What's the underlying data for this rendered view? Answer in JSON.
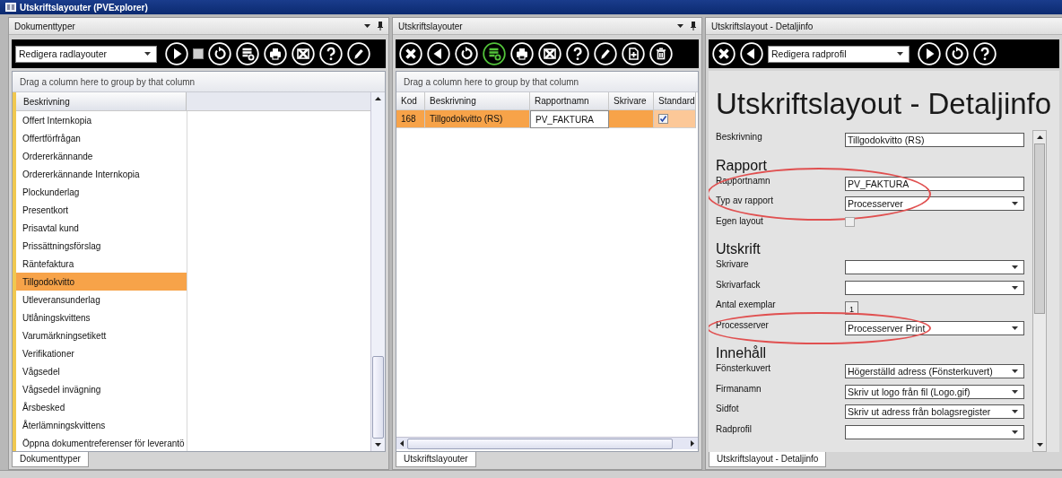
{
  "window": {
    "title": "Utskriftslayouter (PVExplorer)"
  },
  "panes": [
    {
      "kind": "list",
      "title": "Dokumenttyper",
      "pinnable": true,
      "toolbar": [
        {
          "kind": "dropdown",
          "value": "Redigera radlayouter"
        },
        {
          "kind": "play",
          "active": false
        },
        {
          "kind": "stop",
          "active": false
        },
        {
          "kind": "refresh",
          "active": false
        },
        {
          "kind": "columns",
          "active": false
        },
        {
          "kind": "print",
          "active": false
        },
        {
          "kind": "excel",
          "active": false
        },
        {
          "kind": "help",
          "active": false
        },
        {
          "kind": "pencil",
          "active": false
        }
      ],
      "group_hint": "Drag a column here to group by that column",
      "columns": [
        "Beskrivning"
      ],
      "rows": [
        {
          "text": "Offert Internkopia",
          "selected": false
        },
        {
          "text": "Offertförfrågan",
          "selected": false
        },
        {
          "text": "Ordererkännande",
          "selected": false
        },
        {
          "text": "Ordererkännande Internkopia",
          "selected": false
        },
        {
          "text": "Plockunderlag",
          "selected": false
        },
        {
          "text": "Presentkort",
          "selected": false
        },
        {
          "text": "Prisavtal kund",
          "selected": false
        },
        {
          "text": "Prissättningsförslag",
          "selected": false
        },
        {
          "text": "Räntefaktura",
          "selected": false
        },
        {
          "text": "Tillgodokvitto",
          "selected": true
        },
        {
          "text": "Utleveransunderlag",
          "selected": false
        },
        {
          "text": "Utlåningskvittens",
          "selected": false
        },
        {
          "text": "Varumärkningsetikett",
          "selected": false
        },
        {
          "text": "Verifikationer",
          "selected": false
        },
        {
          "text": "Vågsedel",
          "selected": false
        },
        {
          "text": "Vågsedel invägning",
          "selected": false
        },
        {
          "text": "Årsbesked",
          "selected": false
        },
        {
          "text": "Återlämningskvittens",
          "selected": false
        },
        {
          "text": "Öppna dokumentreferenser för leverantö",
          "selected": false
        }
      ],
      "tab": "Dokumenttyper"
    },
    {
      "kind": "table",
      "title": "Utskriftslayouter",
      "pinnable": true,
      "toolbar": [
        {
          "kind": "close",
          "active": false
        },
        {
          "kind": "back",
          "active": false
        },
        {
          "kind": "refresh",
          "active": false
        },
        {
          "kind": "columns",
          "active": true
        },
        {
          "kind": "print",
          "active": false
        },
        {
          "kind": "excel",
          "active": false
        },
        {
          "kind": "help",
          "active": false
        },
        {
          "kind": "pencil",
          "active": false
        },
        {
          "kind": "note",
          "active": false
        },
        {
          "kind": "trash",
          "active": false
        }
      ],
      "group_hint": "Drag a column here to group by that column",
      "columns": [
        "Kod",
        "Beskrivning",
        "Rapportnamn",
        "Skrivare",
        "Standard"
      ],
      "rows": [
        {
          "selected": true,
          "cells": [
            {
              "kind": "text",
              "text": "168",
              "focused": false
            },
            {
              "kind": "text",
              "text": "Tillgodokvitto (RS)",
              "focused": false
            },
            {
              "kind": "text",
              "text": "PV_FAKTURA",
              "focused": true
            },
            {
              "kind": "empty"
            },
            {
              "kind": "checkbox",
              "checked": true
            }
          ]
        }
      ],
      "tab": "Utskriftslayouter"
    },
    {
      "kind": "detail",
      "title": "Utskriftslayout - Detaljinfo",
      "pinnable": false,
      "toolbar": [
        {
          "kind": "close",
          "active": false
        },
        {
          "kind": "back",
          "active": false
        },
        {
          "kind": "dropdown",
          "value": "Redigera radprofil"
        },
        {
          "kind": "play",
          "active": false
        },
        {
          "kind": "refresh",
          "active": false
        },
        {
          "kind": "help",
          "active": false
        }
      ],
      "heading": "Utskriftslayout - Detaljinfo",
      "rows": [
        {
          "kind": "text",
          "label": "Beskrivning",
          "value": "Tillgodokvitto (RS)",
          "circled": false
        },
        {
          "kind": "heading",
          "text": "Rapport",
          "circled": false
        },
        {
          "kind": "text",
          "label": "Rapportnamn",
          "value": "PV_FAKTURA",
          "circled": true
        },
        {
          "kind": "select",
          "label": "Typ av rapport",
          "value": "Processerver",
          "circled": true
        },
        {
          "kind": "checkbox",
          "label": "Egen layout",
          "checked": false,
          "circled": false
        },
        {
          "kind": "heading",
          "text": "Utskrift",
          "circled": false
        },
        {
          "kind": "select",
          "label": "Skrivare",
          "circled": false
        },
        {
          "kind": "select",
          "label": "Skrivarfack",
          "circled": false
        },
        {
          "kind": "number",
          "label": "Antal exemplar",
          "value": "1",
          "circled": false
        },
        {
          "kind": "select",
          "label": "Processerver",
          "value": "Processerver Print",
          "circled": true
        },
        {
          "kind": "heading",
          "text": "Innehåll",
          "circled": false
        },
        {
          "kind": "select",
          "label": "Fönsterkuvert",
          "value": "Högerställd adress (Fönsterkuvert)",
          "circled": false
        },
        {
          "kind": "select",
          "label": "Firmanamn",
          "value": "Skriv ut logo från fil (Logo.gif)",
          "circled": false
        },
        {
          "kind": "select",
          "label": "Sidfot",
          "value": "Skriv ut adress från bolagsregister",
          "circled": false
        },
        {
          "kind": "select",
          "label": "Radprofil",
          "circled": false
        }
      ],
      "tab": "Utskriftslayout - Detaljinfo"
    }
  ]
}
